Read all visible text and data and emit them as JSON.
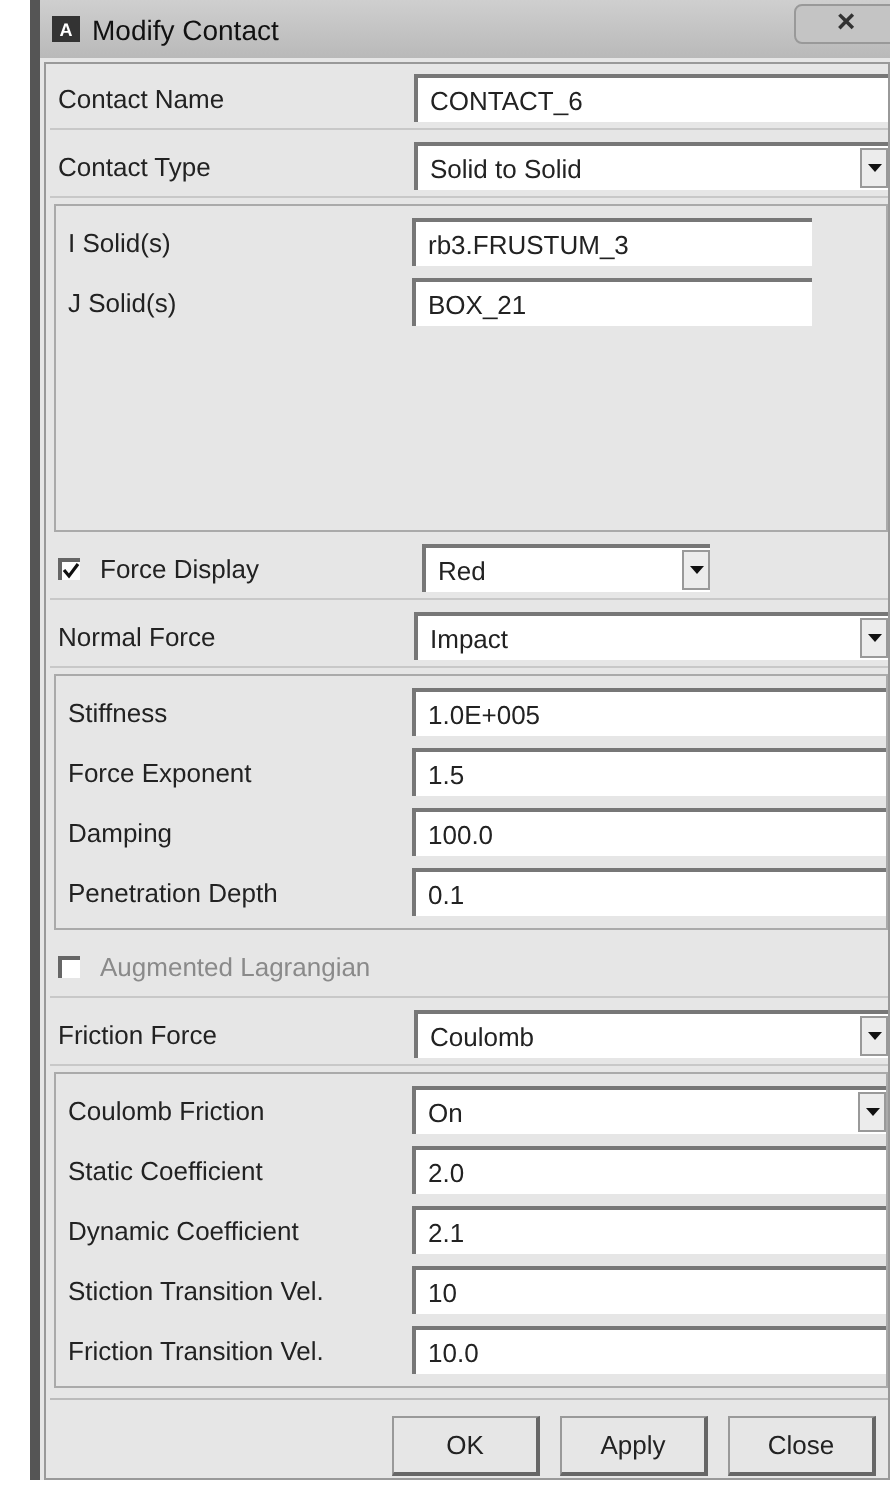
{
  "window": {
    "title": "Modify Contact",
    "app_icon": "A"
  },
  "rows": [
    {
      "kind": "field",
      "label": "Contact Name",
      "value": "CONTACT_6"
    },
    {
      "kind": "dropdown",
      "label": "Contact Type",
      "value": "Solid to Solid"
    },
    {
      "kind": "group",
      "rows": [
        {
          "kind": "short-field",
          "label": "I Solid(s)",
          "value": "rb3.FRUSTUM_3"
        },
        {
          "kind": "short-field",
          "label": "J Solid(s)",
          "value": "BOX_21"
        }
      ]
    },
    {
      "kind": "check-dropdown",
      "label": "Force Display",
      "checked": true,
      "value": "Red"
    },
    {
      "kind": "dropdown",
      "label": "Normal Force",
      "value": "Impact"
    },
    {
      "kind": "group",
      "rows": [
        {
          "kind": "field",
          "label": "Stiffness",
          "value": "1.0E+005"
        },
        {
          "kind": "field",
          "label": "Force Exponent",
          "value": "1.5"
        },
        {
          "kind": "field",
          "label": "Damping",
          "value": "100.0"
        },
        {
          "kind": "field",
          "label": "Penetration Depth",
          "value": "0.1"
        }
      ]
    },
    {
      "kind": "checkbox",
      "label": "Augmented Lagrangian",
      "checked": false,
      "disabled": true
    },
    {
      "kind": "dropdown",
      "label": "Friction Force",
      "value": "Coulomb"
    },
    {
      "kind": "group",
      "rows": [
        {
          "kind": "dropdown",
          "label": "Coulomb Friction",
          "value": "On"
        },
        {
          "kind": "field",
          "label": "Static Coefficient",
          "value": "2.0"
        },
        {
          "kind": "field",
          "label": "Dynamic Coefficient",
          "value": "2.1"
        },
        {
          "kind": "field",
          "label": "Stiction Transition Vel.",
          "value": "10"
        },
        {
          "kind": "field",
          "label": "Friction Transition Vel.",
          "value": "10.0"
        }
      ]
    }
  ],
  "buttons": [
    "OK",
    "Apply",
    "Close"
  ],
  "close_glyph": "×"
}
